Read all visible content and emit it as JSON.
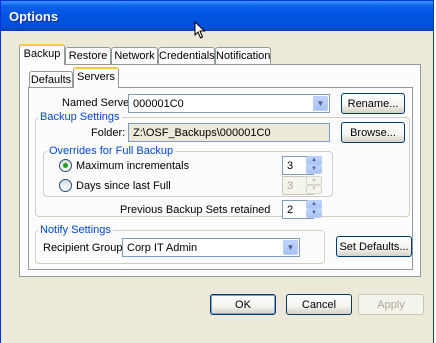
{
  "window": {
    "title": "Options"
  },
  "main_tabs": [
    "Backup",
    "Restore",
    "Network",
    "Credentials",
    "Notification"
  ],
  "sub_tabs": [
    "Defaults",
    "Servers"
  ],
  "named_server": {
    "label": "Named Server",
    "value": "000001C0",
    "rename_label": "Rename..."
  },
  "backup_settings": {
    "legend": "Backup Settings",
    "folder_label": "Folder:",
    "folder_value": "Z:\\OSF_Backups\\000001C0",
    "browse_label": "Browse..."
  },
  "overrides": {
    "legend": "Overrides for Full Backup",
    "max_incrementals_label": "Maximum incrementals",
    "max_incrementals_value": "3",
    "days_since_label": "Days since last Full",
    "days_since_value": "3",
    "selected": "max_incrementals"
  },
  "previous_sets": {
    "label": "Previous Backup Sets retained",
    "value": "2"
  },
  "notify": {
    "legend": "Notify Settings",
    "recipient_label": "Recipient Group",
    "recipient_value": "Corp IT Admin",
    "set_defaults_label": "Set Defaults..."
  },
  "buttons": {
    "ok": "OK",
    "cancel": "Cancel",
    "apply": "Apply"
  },
  "colors": {
    "title_bar": "#0054e3",
    "legend_text": "#0046d5",
    "radio_selected": "#21a121",
    "active_tab_accent": "#ffc83c"
  }
}
